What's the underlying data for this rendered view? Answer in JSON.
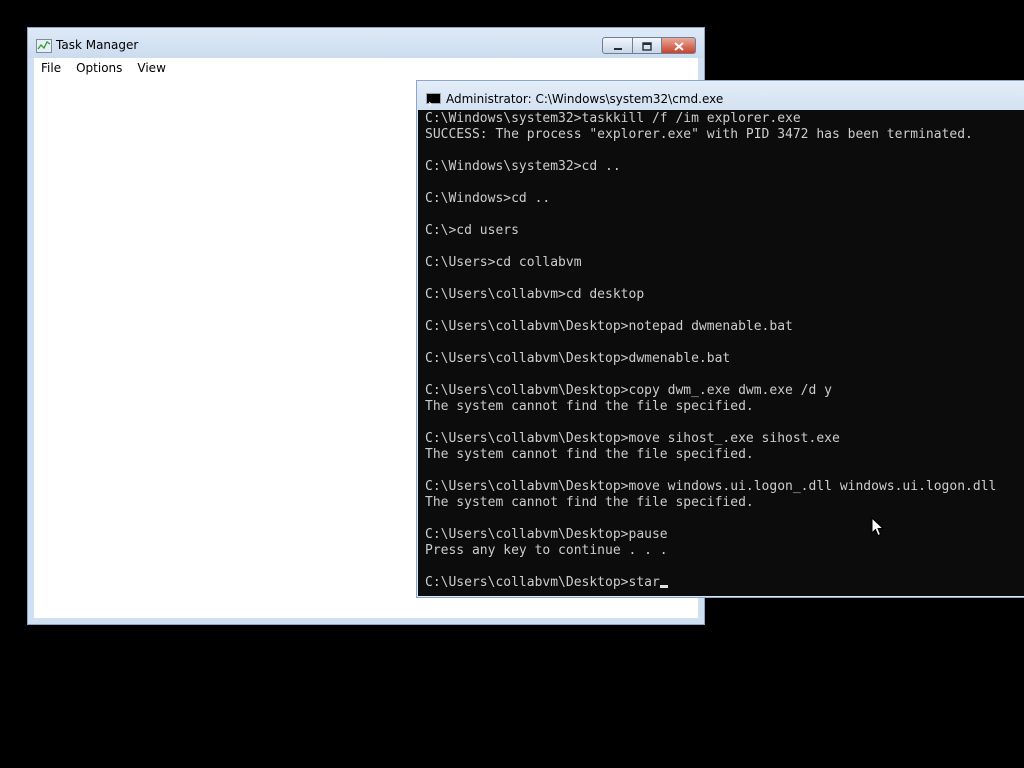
{
  "task_manager": {
    "title": "Task Manager",
    "menu": [
      "File",
      "Options",
      "View"
    ]
  },
  "cmd": {
    "title": "Administrator: C:\\Windows\\system32\\cmd.exe",
    "lines": [
      "C:\\Windows\\system32>taskkill /f /im explorer.exe",
      "SUCCESS: The process \"explorer.exe\" with PID 3472 has been terminated.",
      "",
      "C:\\Windows\\system32>cd ..",
      "",
      "C:\\Windows>cd ..",
      "",
      "C:\\>cd users",
      "",
      "C:\\Users>cd collabvm",
      "",
      "C:\\Users\\collabvm>cd desktop",
      "",
      "C:\\Users\\collabvm\\Desktop>notepad dwmenable.bat",
      "",
      "C:\\Users\\collabvm\\Desktop>dwmenable.bat",
      "",
      "C:\\Users\\collabvm\\Desktop>copy dwm_.exe dwm.exe /d y",
      "The system cannot find the file specified.",
      "",
      "C:\\Users\\collabvm\\Desktop>move sihost_.exe sihost.exe",
      "The system cannot find the file specified.",
      "",
      "C:\\Users\\collabvm\\Desktop>move windows.ui.logon_.dll windows.ui.logon.dll",
      "The system cannot find the file specified.",
      "",
      "C:\\Users\\collabvm\\Desktop>pause",
      "Press any key to continue . . .",
      "",
      "C:\\Users\\collabvm\\Desktop>star"
    ]
  },
  "icons": {
    "task_manager_icon": "task-manager-icon",
    "cmd_icon": "cmd-icon",
    "minimize": "minimize-icon",
    "maximize": "maximize-icon",
    "close": "close-icon",
    "mouse": "mouse-pointer-icon"
  },
  "colors": {
    "desktop": "#000000",
    "console_bg": "#0c0c0c",
    "console_text": "#cccccc",
    "close_button": "#c8432b"
  }
}
